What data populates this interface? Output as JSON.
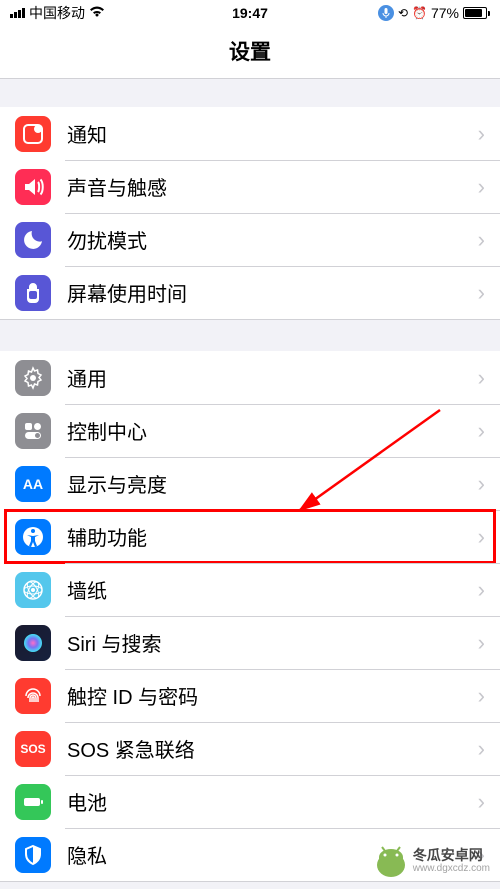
{
  "statusBar": {
    "carrier": "中国移动",
    "time": "19:47",
    "batteryPercent": "77%"
  },
  "header": {
    "title": "设置"
  },
  "sections": [
    {
      "rows": [
        {
          "id": "notifications",
          "label": "通知",
          "icon": "notif"
        },
        {
          "id": "sounds",
          "label": "声音与触感",
          "icon": "sound"
        },
        {
          "id": "dnd",
          "label": "勿扰模式",
          "icon": "dnd"
        },
        {
          "id": "screentime",
          "label": "屏幕使用时间",
          "icon": "screen"
        }
      ]
    },
    {
      "rows": [
        {
          "id": "general",
          "label": "通用",
          "icon": "general"
        },
        {
          "id": "control",
          "label": "控制中心",
          "icon": "control"
        },
        {
          "id": "display",
          "label": "显示与亮度",
          "icon": "display"
        },
        {
          "id": "accessibility",
          "label": "辅助功能",
          "icon": "access",
          "highlighted": true
        },
        {
          "id": "wallpaper",
          "label": "墙纸",
          "icon": "wallpaper"
        },
        {
          "id": "siri",
          "label": "Siri 与搜索",
          "icon": "siri"
        },
        {
          "id": "touchid",
          "label": "触控 ID 与密码",
          "icon": "touchid"
        },
        {
          "id": "sos",
          "label": "SOS 紧急联络",
          "icon": "sos"
        },
        {
          "id": "battery",
          "label": "电池",
          "icon": "battery"
        },
        {
          "id": "privacy",
          "label": "隐私",
          "icon": "privacy"
        }
      ]
    }
  ],
  "watermark": {
    "line1": "冬瓜安卓网",
    "line2": "www.dgxcdz.com"
  }
}
